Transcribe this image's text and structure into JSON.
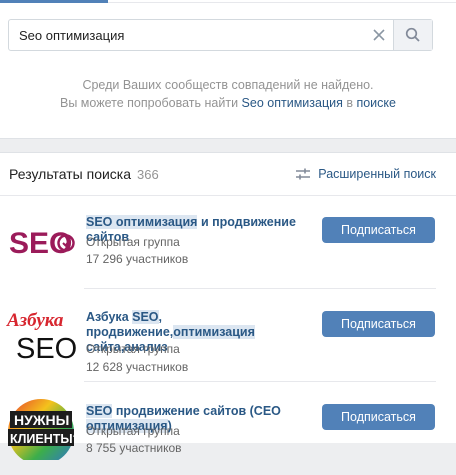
{
  "search": {
    "value": "Seo оптимизация"
  },
  "no_results": {
    "line1": "Среди Ваших сообществ совпадений не найдено.",
    "line2_prefix": "Вы можете попробовать найти ",
    "line2_link": "Seo оптимизация",
    "line2_mid": " в ",
    "line2_search_link": "поиске"
  },
  "results": {
    "title": "Результаты поиска",
    "count": "366",
    "advanced_label": "Расширенный поиск"
  },
  "groups": [
    {
      "name_hl": "SEO оптимизация",
      "name_rest": " и продвижение сайтов",
      "type": "Открытая группа",
      "members": "17 296 участников",
      "button": "Подписаться",
      "logo_text": "SEO"
    },
    {
      "name_line1_a": "Азбука ",
      "name_line1_hl1": "SEO",
      "name_line1_b": ", продвижение,",
      "name_line1_hl2": "оптимизация",
      "name_line2": "сайта,анализ",
      "type": "Открытая группа",
      "members": "12 628 участников",
      "button": "Подписаться",
      "logo_top": "Азбука",
      "logo_bottom": "SEO"
    },
    {
      "name_hl1": "SEO",
      "name_mid": " продвижение сайтов (СЕО ",
      "name_hl2": "оптимизация",
      "name_end": ")",
      "type": "Открытая группа",
      "members": "8 755 участников",
      "button": "Подписаться",
      "logo_top": "НУЖНЫ",
      "logo_bottom": "КЛИЕНТЫ?"
    }
  ],
  "colors": {
    "accent": "#5181b8",
    "link": "#2a5885",
    "logo_seo": "#9b1b5a",
    "logo_azbuka_red": "#d7262f"
  }
}
